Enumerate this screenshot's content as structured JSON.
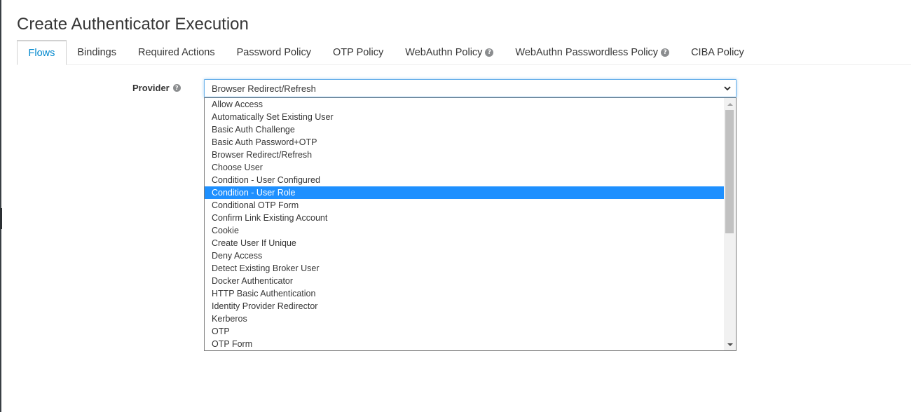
{
  "page": {
    "title": "Create Authenticator Execution"
  },
  "tabs": [
    {
      "label": "Flows",
      "active": true,
      "help": false
    },
    {
      "label": "Bindings",
      "active": false,
      "help": false
    },
    {
      "label": "Required Actions",
      "active": false,
      "help": false
    },
    {
      "label": "Password Policy",
      "active": false,
      "help": false
    },
    {
      "label": "OTP Policy",
      "active": false,
      "help": false
    },
    {
      "label": "WebAuthn Policy",
      "active": false,
      "help": true
    },
    {
      "label": "WebAuthn Passwordless Policy",
      "active": false,
      "help": true
    },
    {
      "label": "CIBA Policy",
      "active": false,
      "help": false
    }
  ],
  "form": {
    "provider_label": "Provider",
    "provider_value": "Browser Redirect/Refresh"
  },
  "dropdown": {
    "highlighted": "Condition - User Role",
    "options": [
      "Allow Access",
      "Automatically Set Existing User",
      "Basic Auth Challenge",
      "Basic Auth Password+OTP",
      "Browser Redirect/Refresh",
      "Choose User",
      "Condition - User Configured",
      "Condition - User Role",
      "Conditional OTP Form",
      "Confirm Link Existing Account",
      "Cookie",
      "Create User If Unique",
      "Deny Access",
      "Detect Existing Broker User",
      "Docker Authenticator",
      "HTTP Basic Authentication",
      "Identity Provider Redirector",
      "Kerberos",
      "OTP",
      "OTP Form"
    ]
  },
  "icons": {
    "help": "question-circle-icon",
    "select_chevron": "chevron-down-icon",
    "scroll_up": "scroll-up-arrow-icon",
    "scroll_down": "scroll-down-arrow-icon"
  },
  "colors": {
    "active_tab": "#0088ce",
    "focus_border": "#66afe9",
    "selected_option": "#1e90ff"
  }
}
